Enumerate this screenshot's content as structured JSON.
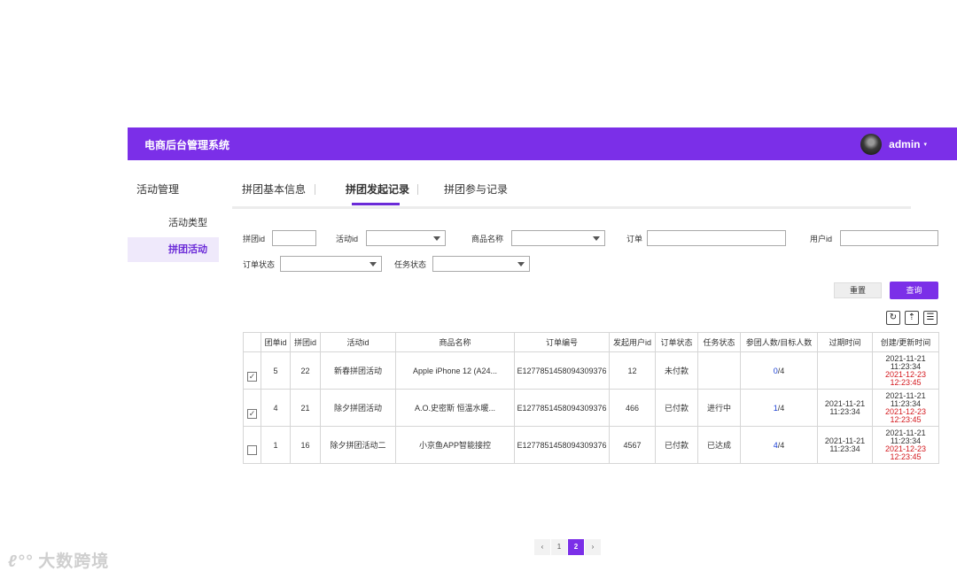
{
  "header": {
    "brand": "电商后台管理系统",
    "user": "admin",
    "caret": "▾"
  },
  "sidebar": {
    "title": "活动管理",
    "items": [
      {
        "label": "活动类型",
        "active": false
      },
      {
        "label": "拼团活动",
        "active": true
      }
    ]
  },
  "tabs": [
    {
      "label": "拼团基本信息"
    },
    {
      "label": "拼团发起记录",
      "active": true
    },
    {
      "label": "拼团参与记录"
    }
  ],
  "filters": {
    "group_id": "拼团id",
    "activity_id": "活动id",
    "product_name": "商品名称",
    "order": "订单",
    "user_id": "用户id",
    "order_status": "订单状态",
    "task_status": "任务状态"
  },
  "buttons": {
    "reset": "重置",
    "query": "查询"
  },
  "toolbar": {
    "refresh": "↻",
    "export": "⇡",
    "columns": "☰"
  },
  "table": {
    "headers": [
      "",
      "团单id",
      "拼团id",
      "活动id",
      "商品名称",
      "订单编号",
      "发起用户id",
      "订单状态",
      "任务状态",
      "参团人数/目标人数",
      "过期时间",
      "创建/更新时间"
    ],
    "rows": [
      {
        "checked": true,
        "team_id": "5",
        "group_id": "22",
        "activity": "新春拼团活动",
        "product": "Apple iPhone 12 (A24...",
        "order_no": "E1277851458094309376",
        "user_id": "12",
        "order_status": "未付款",
        "task_status": "",
        "joined": "0",
        "target": "/4",
        "expire_date": "",
        "expire_time": "",
        "created_date": "2021-11-21",
        "created_time": "11:23:34",
        "updated_date": "2021-12-23",
        "updated_time": "12:23:45"
      },
      {
        "checked": true,
        "team_id": "4",
        "group_id": "21",
        "activity": "除夕拼团活动",
        "product": "A.O.史密斯 恒温水暖...",
        "order_no": "E1277851458094309376",
        "user_id": "466",
        "order_status": "已付款",
        "task_status": "进行中",
        "joined": "1",
        "target": "/4",
        "expire_date": "2021-11-21",
        "expire_time": "11:23:34",
        "created_date": "2021-11-21",
        "created_time": "11:23:34",
        "updated_date": "2021-12-23",
        "updated_time": "12:23:45"
      },
      {
        "checked": false,
        "team_id": "1",
        "group_id": "16",
        "activity": "除夕拼团活动二",
        "product": "小京鱼APP智能接控",
        "order_no": "E1277851458094309376",
        "user_id": "4567",
        "order_status": "已付款",
        "task_status": "已达成",
        "joined": "4",
        "target": "/4",
        "expire_date": "2021-11-21",
        "expire_time": "11:23:34",
        "created_date": "2021-11-21",
        "created_time": "11:23:34",
        "updated_date": "2021-12-23",
        "updated_time": "12:23:45"
      }
    ]
  },
  "pagination": {
    "prev": "‹",
    "page1": "1",
    "page2": "2",
    "next": "›"
  },
  "watermark": {
    "logo": "ℓ°°",
    "text": "大数跨境"
  },
  "colors": {
    "primary": "#7b2fe8",
    "active_bg": "#efe9fb",
    "red": "#d4191e",
    "blue": "#1a3fd6"
  }
}
